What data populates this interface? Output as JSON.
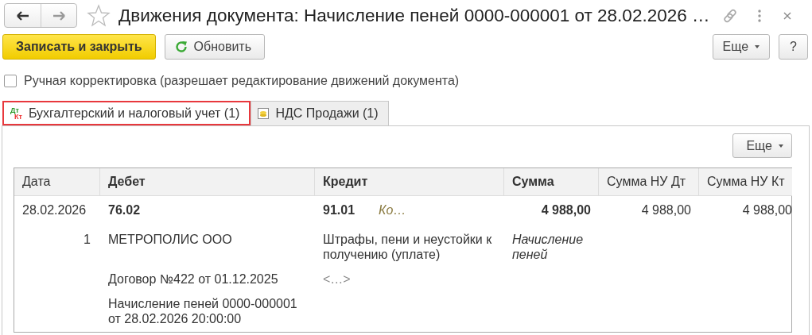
{
  "window": {
    "title": "Движения документа: Начисление пеней 0000-000001 от 28.02.2026 …"
  },
  "toolbar": {
    "buttons": [
      {
        "label": "Записать и закрыть",
        "kind": "primary"
      },
      {
        "label": "Обновить",
        "kind": "refresh"
      }
    ],
    "more": "Еще",
    "help": "?"
  },
  "manual_correction": {
    "label": "Ручная корректировка (разрешает редактирование движений документа)",
    "checked": false
  },
  "tabs": [
    {
      "label": "Бухгалтерский и налоговый учет (1)",
      "selected": true,
      "kind": "accounting",
      "icon_labels": [
        "Дт",
        "Кт"
      ]
    },
    {
      "label": "НДС Продажи (1)",
      "selected": false,
      "kind": "vat"
    }
  ],
  "table": {
    "more": "Еще",
    "columns": [
      {
        "label": "Дата",
        "bold": false
      },
      {
        "label": "Дебет",
        "bold": true
      },
      {
        "label": "Кредит",
        "bold": true
      },
      {
        "label": "Сумма",
        "bold": true
      },
      {
        "label": "Сумма НУ Дт",
        "bold": false
      },
      {
        "label": "Сумма НУ Кт",
        "bold": false
      }
    ],
    "rows": [
      {
        "date": "28.02.2026",
        "line_number": "1",
        "debit": {
          "account": "76.02",
          "subconto": [
            "МЕТРОПОЛИС ООО",
            "Договор №422 от 01.12.2025",
            "Начисление пеней 0000-000001 от 28.02.2026 20:00:00"
          ]
        },
        "credit": {
          "account": "91.01",
          "note": "Ко…",
          "subconto": [
            "Штрафы, пени и неустойки к получению (уплате)",
            "<…>"
          ]
        },
        "amount": "4 988,00",
        "amount_note": "Начисление пеней",
        "tax_dt": "4 988,00",
        "tax_kt": "4 988,00"
      }
    ]
  }
}
